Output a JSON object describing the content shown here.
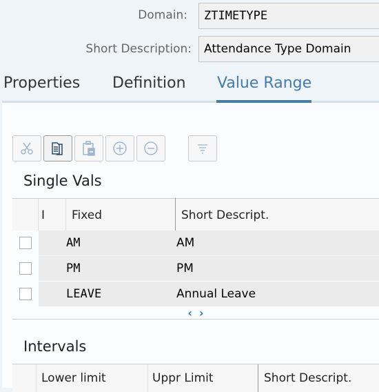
{
  "header": {
    "domain_label": "Domain:",
    "domain_value": "ZTIMETYPE",
    "short_desc_label": "Short Description:",
    "short_desc_value": "Attendance Type Domain"
  },
  "tabs": [
    {
      "label": "Properties",
      "active": false
    },
    {
      "label": "Definition",
      "active": false
    },
    {
      "label": "Value Range",
      "active": true
    }
  ],
  "toolbar": {
    "buttons": [
      {
        "name": "cut",
        "icon": "scissors-icon",
        "enabled": false
      },
      {
        "name": "copy",
        "icon": "copy-icon",
        "enabled": true
      },
      {
        "name": "paste",
        "icon": "paste-icon",
        "enabled": false
      },
      {
        "name": "insert-row",
        "icon": "plus-circle-icon",
        "enabled": false
      },
      {
        "name": "delete-row",
        "icon": "minus-circle-icon",
        "enabled": false
      },
      {
        "name": "filter",
        "icon": "filter-icon",
        "enabled": false
      }
    ]
  },
  "single_vals": {
    "title": "Single Vals",
    "columns": [
      "I",
      "Fixed",
      "Short Descript."
    ],
    "rows": [
      {
        "fixed": "AM",
        "desc": "AM"
      },
      {
        "fixed": "PM",
        "desc": "PM"
      },
      {
        "fixed": "LEAVE",
        "desc": "Annual Leave"
      }
    ],
    "scroll_left": "‹",
    "scroll_right": "›"
  },
  "intervals": {
    "title": "Intervals",
    "columns": [
      "Lower limit",
      "Uppr Limit",
      "Short Descript."
    ]
  },
  "colors": {
    "accent": "#427cac",
    "background": "#eff4f9"
  }
}
